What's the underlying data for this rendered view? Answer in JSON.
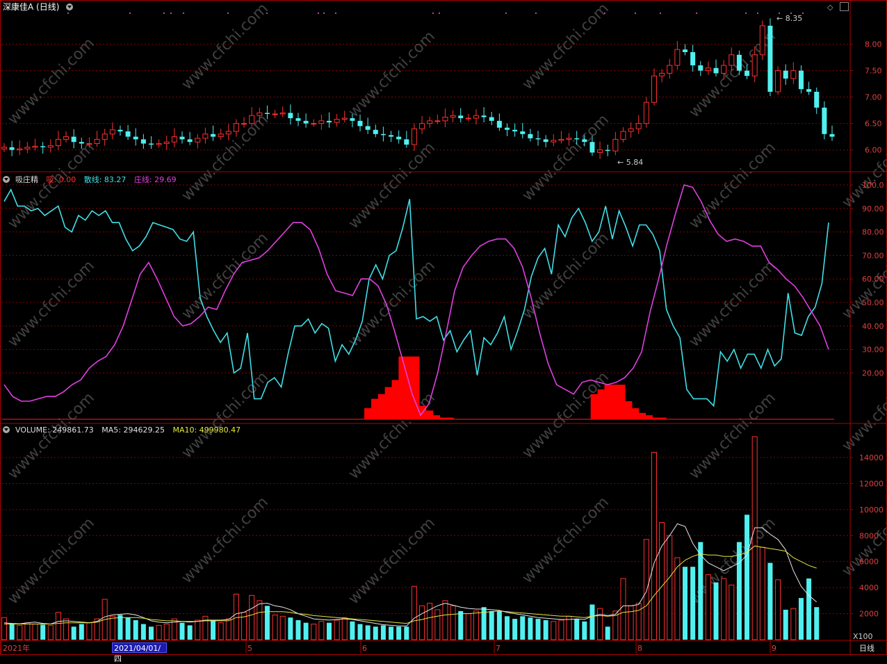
{
  "title": {
    "stock": "深康佳A",
    "period": "(日线)"
  },
  "price_pane": {
    "high_marker": "8.35",
    "low_marker": "5.84",
    "y_ticks": [
      "8.00",
      "7.50",
      "7.00",
      "6.50",
      "6.00"
    ]
  },
  "indicator_pane": {
    "name": "吸庄精",
    "items": [
      {
        "label": "吸: 0.00",
        "color": "#ff3030"
      },
      {
        "label": "散线: 83.27",
        "color": "#40e0e8"
      },
      {
        "label": "庄线: 29.69",
        "color": "#e040e0"
      }
    ],
    "y_ticks": [
      "100.0",
      "90.00",
      "80.00",
      "70.00",
      "60.00",
      "50.00",
      "40.00",
      "30.00",
      "20.00"
    ]
  },
  "volume_pane": {
    "items": [
      {
        "label": "VOLUME: 249861.73",
        "color": "#e0e0e0"
      },
      {
        "label": "MA5: 294629.25",
        "color": "#e0e0e0"
      },
      {
        "label": "MA10: 499980.47",
        "color": "#e8e840"
      }
    ],
    "y_ticks": [
      "14000",
      "12000",
      "10000",
      "8000",
      "6000",
      "4000",
      "2000"
    ],
    "unit": "X100"
  },
  "x_axis": {
    "labels": [
      "2021年",
      "5",
      "6",
      "7",
      "8",
      "9"
    ],
    "selected_date": "2021/04/01/四",
    "period_label": "日线"
  },
  "watermark": "www.cfchi.com",
  "colors": {
    "up": "#ff3030",
    "down": "#50f0f0",
    "grid": "#8b0000",
    "scatter_line": "#40e0e8",
    "banker_line": "#e040e0",
    "absorb_bar": "#ff0000"
  },
  "chart_data": [
    {
      "type": "candlestick",
      "title": "深康佳A (日线)",
      "y_range": [
        5.6,
        8.6
      ],
      "high": 8.35,
      "low": 5.84,
      "close_series": [
        6.05,
        6.0,
        6.02,
        6.05,
        6.07,
        6.05,
        6.08,
        6.2,
        6.25,
        6.15,
        6.12,
        6.12,
        6.2,
        6.3,
        6.38,
        6.35,
        6.25,
        6.2,
        6.12,
        6.1,
        6.12,
        6.15,
        6.25,
        6.2,
        6.15,
        6.22,
        6.3,
        6.25,
        6.3,
        6.35,
        6.5,
        6.5,
        6.65,
        6.7,
        6.68,
        6.68,
        6.7,
        6.6,
        6.55,
        6.5,
        6.5,
        6.55,
        6.52,
        6.58,
        6.6,
        6.55,
        6.45,
        6.38,
        6.3,
        6.28,
        6.25,
        6.2,
        6.1,
        6.4,
        6.5,
        6.55,
        6.55,
        6.62,
        6.65,
        6.6,
        6.6,
        6.65,
        6.62,
        6.55,
        6.42,
        6.38,
        6.35,
        6.3,
        6.22,
        6.2,
        6.15,
        6.18,
        6.2,
        6.22,
        6.2,
        6.15,
        5.95,
        6.0,
        5.98,
        6.2,
        6.35,
        6.4,
        6.5,
        6.9,
        7.4,
        7.45,
        7.6,
        7.9,
        7.85,
        7.6,
        7.5,
        7.55,
        7.45,
        7.6,
        7.8,
        7.5,
        7.4,
        7.8,
        8.35,
        7.1,
        7.5,
        7.35,
        7.5,
        7.15,
        7.1,
        6.8,
        6.3,
        6.25
      ],
      "volume_series": [
        1700,
        1200,
        1100,
        1300,
        1200,
        1150,
        1100,
        2100,
        1600,
        1000,
        1200,
        1300,
        1600,
        3100,
        1800,
        1900,
        1700,
        1500,
        1200,
        1000,
        1100,
        1200,
        1600,
        1300,
        1100,
        1500,
        1800,
        1500,
        1300,
        1600,
        3500,
        2100,
        3400,
        3000,
        2600,
        1900,
        1800,
        1700,
        1500,
        1300,
        1200,
        1400,
        1300,
        1500,
        1700,
        1400,
        1200,
        1100,
        1000,
        1100,
        1000,
        1000,
        1000,
        4100,
        2600,
        2800,
        2300,
        3000,
        2600,
        2200,
        2000,
        2200,
        2500,
        2200,
        2200,
        1800,
        1600,
        1800,
        1700,
        1600,
        1500,
        1400,
        1500,
        1800,
        1600,
        1400,
        2700,
        2400,
        1000,
        2200,
        4700,
        2600,
        2800,
        7700,
        14400,
        9000,
        8000,
        6300,
        5600,
        5600,
        7500,
        5000,
        4400,
        4700,
        4200,
        7500,
        9600,
        15600,
        7100,
        5900,
        4600,
        2300,
        2400,
        3200,
        4700,
        2500
      ],
      "ma5": [
        1300,
        1250,
        1220,
        1300,
        1350,
        1250,
        1200,
        1400,
        1450,
        1400,
        1350,
        1300,
        1400,
        1750,
        1900,
        1950,
        2000,
        1900,
        1700,
        1450,
        1350,
        1300,
        1350,
        1400,
        1350,
        1400,
        1500,
        1500,
        1500,
        1550,
        2000,
        2100,
        2400,
        2750,
        2800,
        2600,
        2500,
        2300,
        2000,
        1800,
        1600,
        1550,
        1500,
        1550,
        1600,
        1550,
        1450,
        1350,
        1250,
        1150,
        1100,
        1050,
        1050,
        1650,
        2000,
        2300,
        2600,
        2800,
        2650,
        2500,
        2400,
        2350,
        2350,
        2300,
        2250,
        2100,
        2000,
        1900,
        1800,
        1700,
        1650,
        1600,
        1550,
        1550,
        1600,
        1550,
        1800,
        1950,
        1850,
        1950,
        2600,
        2600,
        2700,
        3700,
        5900,
        7200,
        8000,
        8900,
        8700,
        7400,
        6500,
        5900,
        5600,
        5300,
        5600,
        5900,
        6500,
        8600,
        8600,
        8100,
        7700,
        6900,
        5300,
        4100,
        3400,
        2900
      ],
      "ma10": [
        1200,
        1200,
        1200,
        1200,
        1200,
        1200,
        1200,
        1250,
        1300,
        1300,
        1300,
        1300,
        1350,
        1550,
        1650,
        1700,
        1700,
        1700,
        1650,
        1550,
        1500,
        1450,
        1450,
        1400,
        1400,
        1400,
        1450,
        1450,
        1450,
        1450,
        1700,
        1750,
        1900,
        2100,
        2150,
        2150,
        2150,
        2100,
        2000,
        1950,
        1850,
        1800,
        1750,
        1700,
        1650,
        1600,
        1550,
        1500,
        1450,
        1400,
        1350,
        1300,
        1250,
        1450,
        1550,
        1700,
        1800,
        1900,
        1950,
        2000,
        2000,
        2050,
        2100,
        2150,
        2200,
        2150,
        2100,
        2050,
        2000,
        1950,
        1900,
        1850,
        1800,
        1800,
        1750,
        1700,
        1800,
        1850,
        1800,
        1850,
        2100,
        2150,
        2250,
        2600,
        3400,
        4100,
        4800,
        5600,
        6100,
        6400,
        6600,
        6500,
        6500,
        6400,
        6400,
        6500,
        6700,
        7200,
        7100,
        7000,
        6900,
        6800,
        6300,
        6000,
        5700,
        5500
      ]
    },
    {
      "type": "line",
      "title": "吸庄精",
      "y_range": [
        0,
        100
      ],
      "series": [
        {
          "name": "吸",
          "values": [
            0,
            0,
            0,
            0,
            0,
            0,
            0,
            0,
            0,
            0,
            0,
            0,
            0,
            0,
            0,
            0,
            0,
            0,
            0,
            0,
            0,
            0,
            0,
            0,
            0,
            0,
            0,
            0,
            0,
            0,
            0,
            0,
            0,
            0,
            0,
            0,
            0,
            0,
            0,
            0,
            0,
            0,
            0,
            0,
            0,
            0,
            0,
            0,
            0,
            0,
            0,
            0,
            0,
            5,
            9,
            11,
            14,
            17,
            27,
            27,
            27,
            6,
            4,
            2,
            1,
            1,
            0,
            0,
            0,
            0,
            0,
            0,
            0,
            0,
            0,
            0,
            0,
            0,
            0,
            0,
            0,
            0,
            0,
            0,
            0,
            0,
            11,
            13,
            15,
            15,
            15,
            8,
            5,
            3,
            2,
            1,
            1,
            0,
            0,
            0,
            0,
            0,
            0,
            0,
            0,
            0,
            0,
            0,
            0,
            0,
            0,
            0,
            0,
            0,
            0,
            0,
            0,
            0,
            0,
            0,
            0,
            0
          ]
        },
        {
          "name": "散线",
          "values": [
            93,
            98,
            91,
            91,
            89,
            90,
            87,
            89,
            91,
            82,
            80,
            87,
            85,
            89,
            87,
            89,
            84,
            84,
            77,
            72,
            74,
            78,
            84,
            83,
            82,
            81,
            77,
            76,
            80,
            52,
            44,
            38,
            33,
            37,
            20,
            22,
            37,
            9,
            9,
            16,
            18,
            14,
            28,
            40,
            40,
            43,
            37,
            41,
            39,
            25,
            32,
            28,
            34,
            42,
            60,
            66,
            60,
            70,
            72,
            82,
            94,
            43,
            44,
            42,
            44,
            34,
            38,
            29,
            34,
            38,
            19,
            35,
            32,
            37,
            44,
            30,
            38,
            47,
            61,
            69,
            73,
            62,
            83,
            78,
            86,
            90,
            84,
            76,
            80,
            91,
            77,
            89,
            82,
            74,
            83,
            83,
            79,
            72,
            47,
            40,
            35,
            13,
            9,
            9,
            9,
            6,
            29,
            25,
            30,
            22,
            28,
            28,
            22,
            30,
            23,
            26,
            54,
            37,
            36,
            44,
            48,
            58,
            84
          ]
        },
        {
          "name": "庄线",
          "values": [
            15,
            10,
            8,
            8,
            9,
            10,
            10,
            12,
            15,
            17,
            22,
            25,
            27,
            32,
            40,
            51,
            62,
            67,
            60,
            52,
            44,
            40,
            41,
            44,
            48,
            47,
            55,
            62,
            67,
            68,
            69,
            72,
            76,
            80,
            84,
            84,
            81,
            73,
            62,
            55,
            54,
            53,
            60,
            60,
            57,
            49,
            37,
            24,
            11,
            2,
            7,
            20,
            37,
            55,
            65,
            70,
            74,
            76,
            77,
            77,
            73,
            65,
            52,
            37,
            24,
            15,
            13,
            11,
            16,
            17,
            16,
            15,
            16,
            18,
            22,
            29,
            46,
            60,
            75,
            88,
            100,
            99,
            93,
            85,
            79,
            76,
            77,
            76,
            74,
            74,
            67,
            64,
            60,
            57,
            52,
            46,
            40,
            30
          ]
        }
      ]
    },
    {
      "type": "bar",
      "title": "VOLUME",
      "y_range": [
        0,
        15600
      ],
      "unit": "X100"
    }
  ]
}
